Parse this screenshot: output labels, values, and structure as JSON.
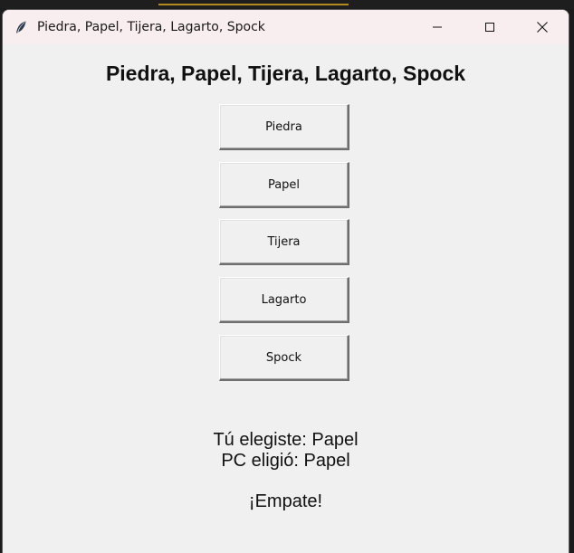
{
  "window": {
    "title": "Piedra, Papel, Tijera, Lagarto, Spock",
    "icon": "feather-icon"
  },
  "game": {
    "heading": "Piedra, Papel, Tijera, Lagarto, Spock",
    "choices": [
      "Piedra",
      "Papel",
      "Tijera",
      "Lagarto",
      "Spock"
    ],
    "user_choice_line": "Tú elegiste: Papel",
    "pc_choice_line": "PC eligió: Papel",
    "outcome": "¡Empate!"
  },
  "colors": {
    "titlebar": "#f9eeef",
    "window_bg": "#f0f0f0",
    "text": "#111111"
  }
}
